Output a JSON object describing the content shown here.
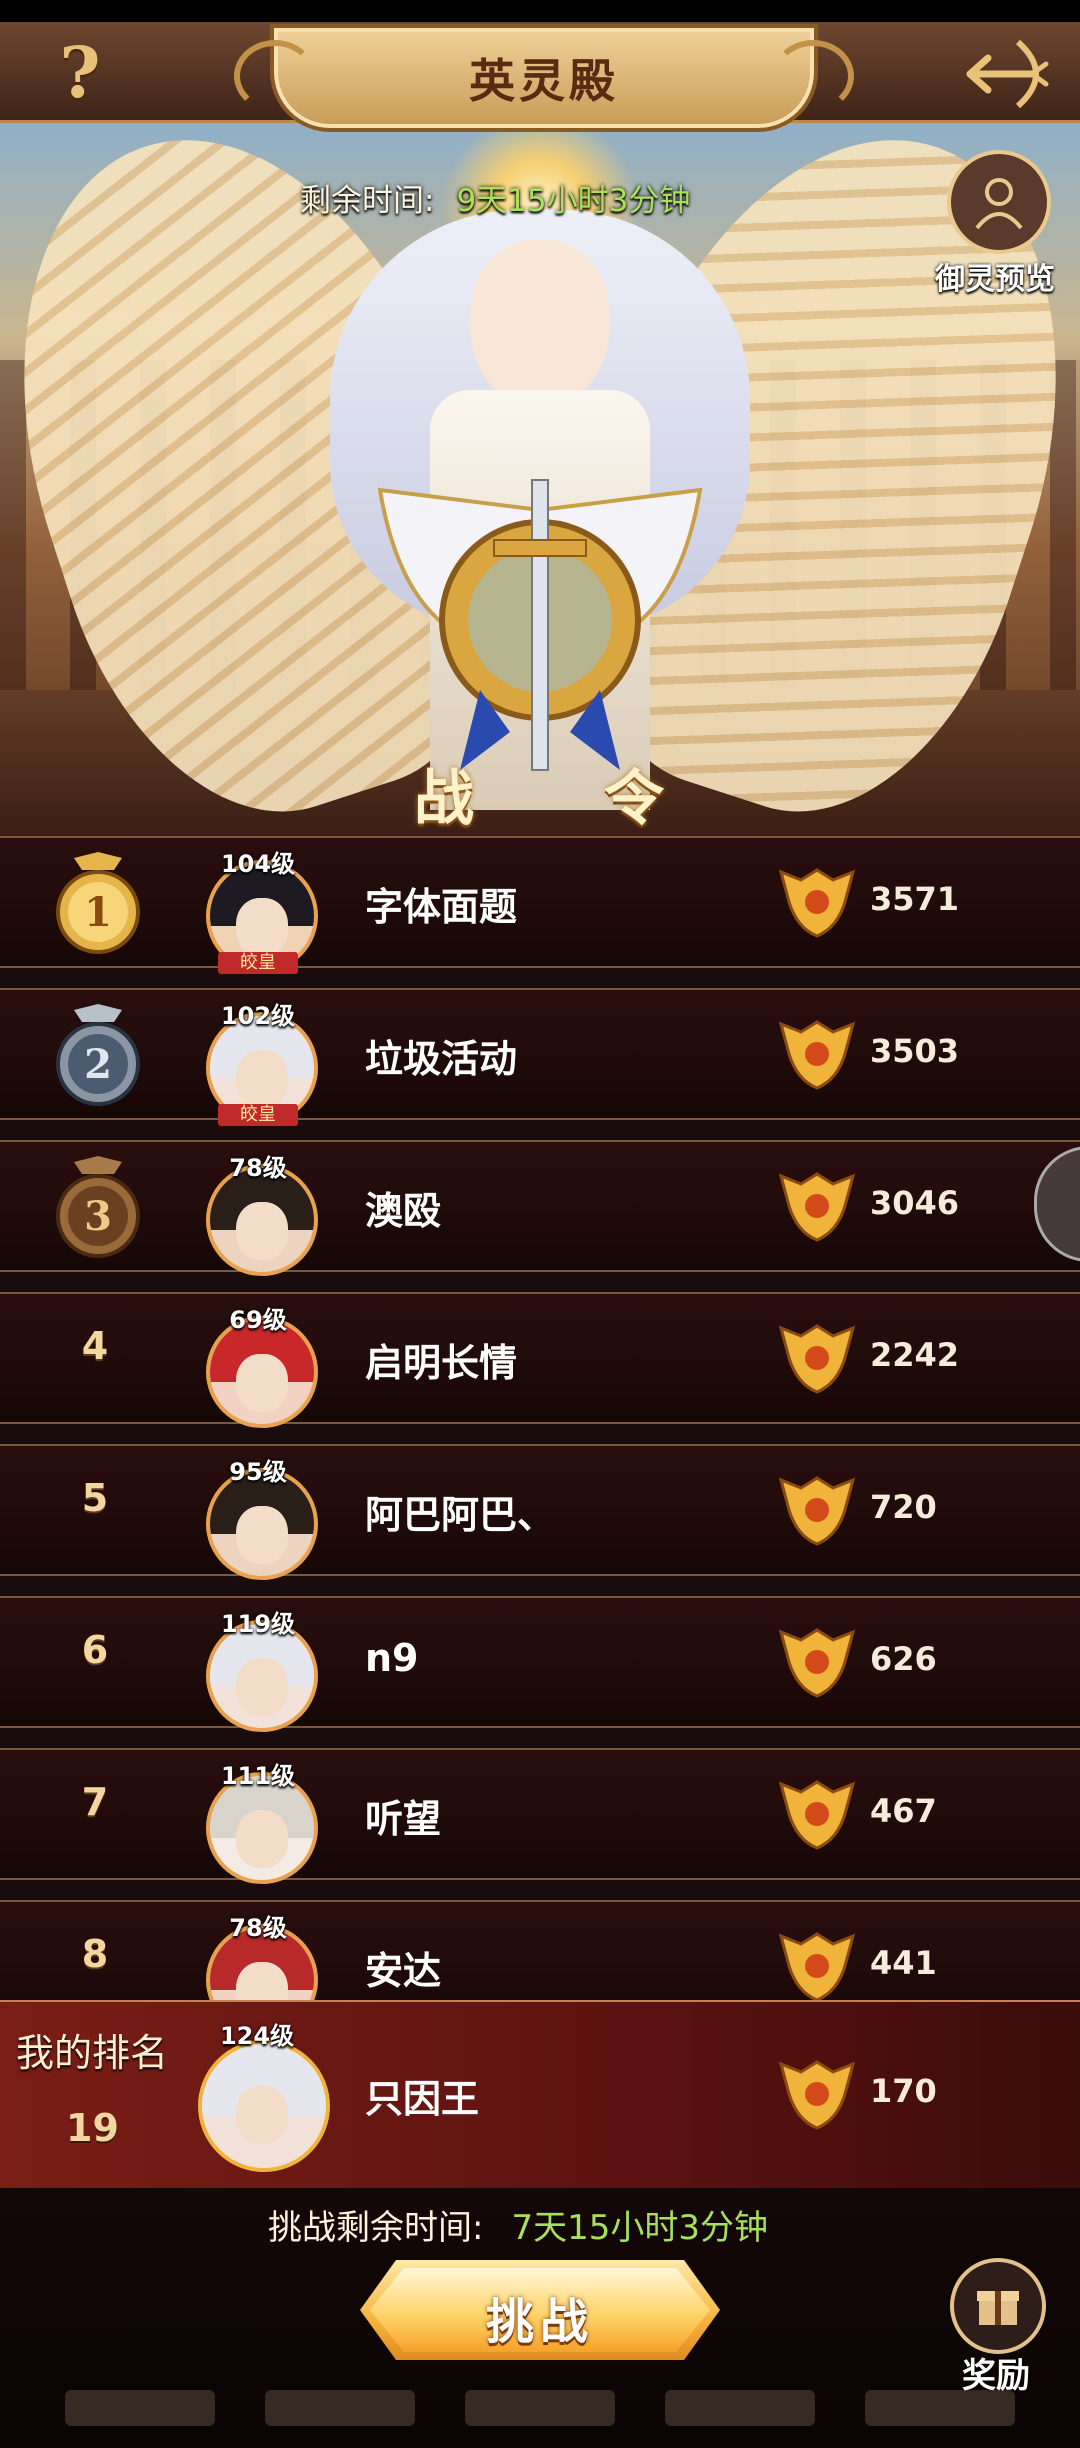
{
  "header": {
    "title": "英灵殿",
    "help_icon": "question-mark-icon",
    "back_icon": "bow-arrow-icon"
  },
  "event": {
    "remaining_label": "剩余时间:",
    "remaining_value": "9天15小时3分钟",
    "preview_label": "御灵预览",
    "emblem_word_left": "战",
    "emblem_word_right": "令"
  },
  "ranking": {
    "rows": [
      {
        "rank": "1",
        "level": "104级",
        "vip": "皎皇",
        "name": "字体面题",
        "score": "3571"
      },
      {
        "rank": "2",
        "level": "102级",
        "vip": "皎皇",
        "name": "垃圾活动",
        "score": "3503"
      },
      {
        "rank": "3",
        "level": "78级",
        "vip": "",
        "name": "澳殴",
        "score": "3046"
      },
      {
        "rank": "4",
        "level": "69级",
        "vip": "",
        "name": "启明长情",
        "score": "2242"
      },
      {
        "rank": "5",
        "level": "95级",
        "vip": "",
        "name": "阿巴阿巴、",
        "score": "720"
      },
      {
        "rank": "6",
        "level": "119级",
        "vip": "",
        "name": "n9",
        "score": "626"
      },
      {
        "rank": "7",
        "level": "111级",
        "vip": "",
        "name": "听望",
        "score": "467"
      },
      {
        "rank": "8",
        "level": "78级",
        "vip": "",
        "name": "安达",
        "score": "441"
      }
    ]
  },
  "my_rank": {
    "label": "我的排名",
    "rank": "19",
    "level": "124级",
    "name": "只因王",
    "score": "170"
  },
  "bottom": {
    "challenge_label": "挑战剩余时间:",
    "challenge_value": "7天15小时3分钟",
    "challenge_button": "挑战",
    "reward_label": "奖励"
  },
  "colors": {
    "gold": "#e8b04a",
    "time_green": "#a8e05a",
    "row_bg": "#1f0a0a",
    "my_row_bg": "#6a1812"
  }
}
